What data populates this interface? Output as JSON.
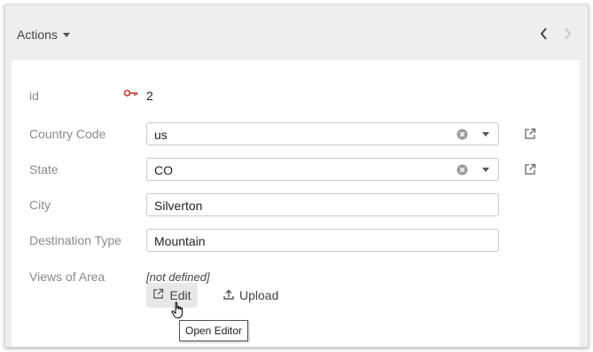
{
  "toolbar": {
    "actions_label": "Actions",
    "prev_icon": "chevron-left-icon",
    "next_icon": "chevron-right-icon"
  },
  "record": {
    "id": {
      "label": "id",
      "value": "2",
      "icon": "key-icon"
    },
    "country_code": {
      "label": "Country Code",
      "value": "us"
    },
    "state": {
      "label": "State",
      "value": "CO"
    },
    "city": {
      "label": "City",
      "value": "Silverton"
    },
    "destination_type": {
      "label": "Destination Type",
      "value": "Mountain"
    },
    "views_of_area": {
      "label": "Views of Area",
      "value": "[not defined]",
      "edit_label": "Edit",
      "upload_label": "Upload"
    }
  },
  "tooltip": {
    "text": "Open Editor"
  },
  "colors": {
    "background": "#eeeeee",
    "panel": "#ffffff",
    "label": "#8a8a8a",
    "key_icon": "#c0392b"
  }
}
